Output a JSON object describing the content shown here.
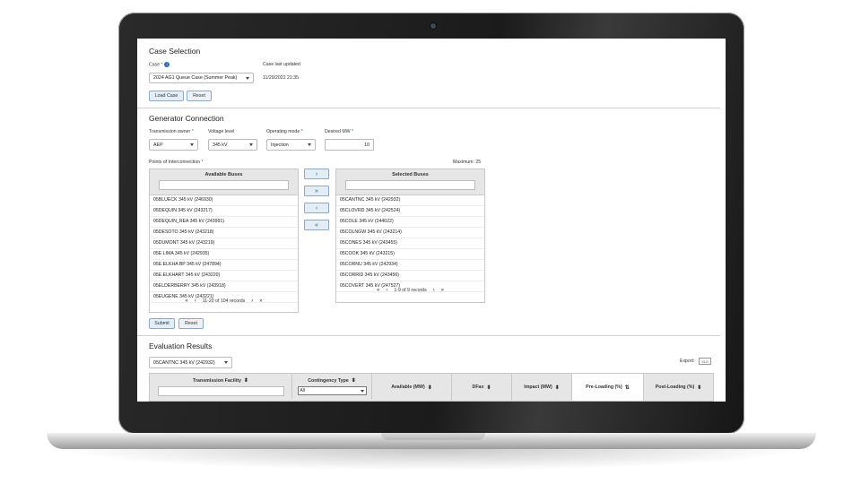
{
  "case_selection": {
    "title": "Case Selection",
    "case_label": "Case",
    "case_required": "*",
    "case_value": "2024 AG1 Queue Case (Summer Peak)",
    "last_updated_label": "Case last updated",
    "last_updated_value": "11/29/2022 21:35",
    "load_case_btn": "Load Case",
    "reset_btn": "Reset"
  },
  "generator": {
    "title": "Generator Connection",
    "owner_label": "Transmission owner",
    "owner_required": "*",
    "owner_value": "AEP",
    "voltage_label": "Voltage level",
    "voltage_value": "345 kV",
    "mode_label": "Operating mode",
    "mode_required": "*",
    "mode_value": "Injection",
    "mw_label": "Desired MW",
    "mw_required": "*",
    "mw_value": "10",
    "poi_label": "Points of Interconnection",
    "poi_required": "*",
    "maximum_text": "Maximum: 25",
    "available_title": "Available Buses",
    "available": [
      "05BLUECK 345 kV (246930)",
      "05DEQUIN 345 kV (243217)",
      "05DEQUIN_REA 345 kV (243991)",
      "05DESOTO 345 kV (243218)",
      "05DUMONT 345 kV (243219)",
      "05E LIMA 345 kV (242935)",
      "05E.ELKHA BP 345 kV (247894)",
      "05E.ELKHART 345 kV (243220)",
      "05ELDERBERRY 345 kV (243918)",
      "05EUGENE 345 kV (243221)"
    ],
    "available_pager": "11-20 of 104 records",
    "selected_title": "Selected Buses",
    "selected": [
      "05CANTNC 345 kV (242932)",
      "05CLOVRD 345 kV (242524)",
      "05COLE 345 kV (244022)",
      "05COLNGW 345 kV (243214)",
      "05CONES 345 kV (243455)",
      "05COOK 345 kV (243215)",
      "05CORNU 345 kV (242934)",
      "05CORRID 345 kV (243456)",
      "05COVERT 345 kV (247527)"
    ],
    "selected_pager": "1-9 of 9 records",
    "submit_btn": "Submit",
    "reset_btn": "Reset"
  },
  "move_buttons": {
    "add_one": "›",
    "add_all": "»",
    "remove_one": "‹",
    "remove_all": "«"
  },
  "pager_icons": {
    "first": "«",
    "prev": "‹",
    "next": "›",
    "last": "»"
  },
  "evaluation": {
    "title": "Evaluation Results",
    "bus_value": "05CANTNC 345 kV (242932)",
    "export_label": "Export:",
    "export_btn": "XLS",
    "columns": [
      "Transmission Facility",
      "Contingency Type",
      "Available (MW)",
      "DFax",
      "Impact (MW)",
      "Pre-Loading (%)",
      "Post-Loading (%)"
    ],
    "contingency_filter": "All",
    "sort_icon": "⬍",
    "sort_active_icon": "⇅"
  }
}
